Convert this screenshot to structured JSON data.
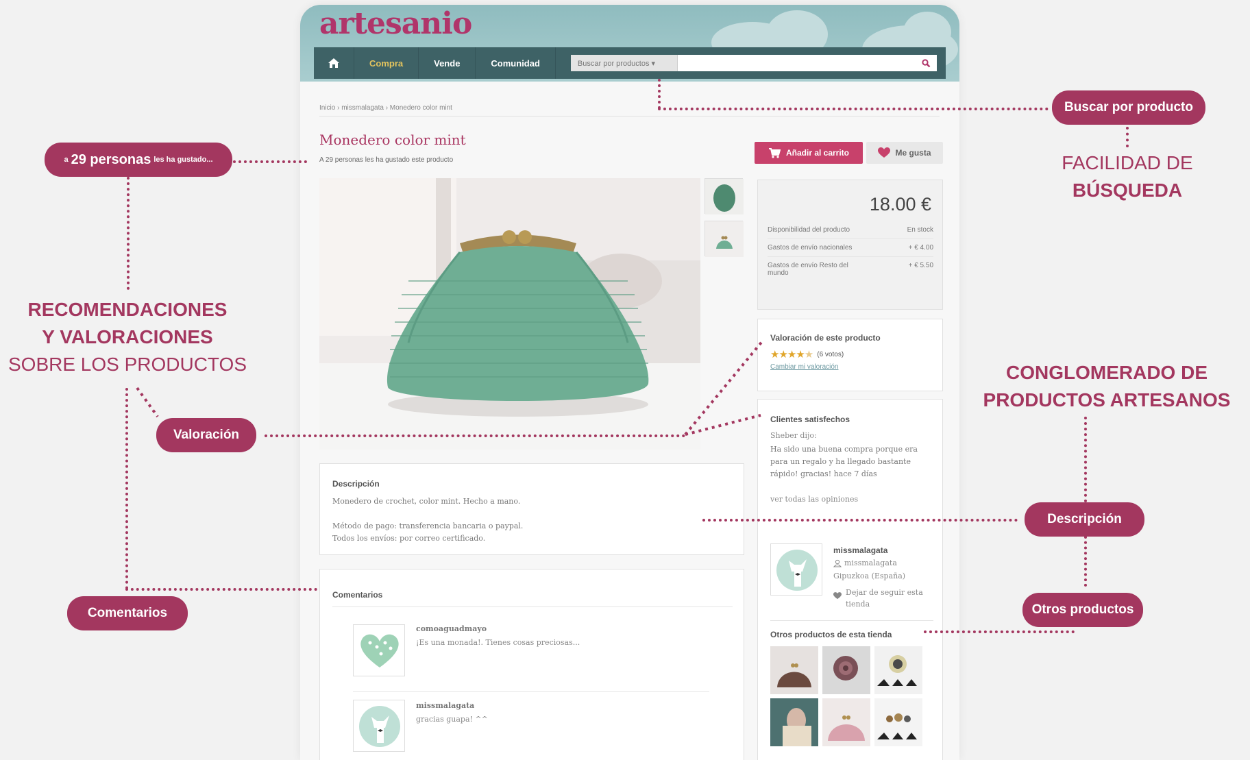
{
  "site": {
    "logo": "artesanio",
    "nav": {
      "compra": "Compra",
      "vende": "Vende",
      "comunidad": "Comunidad"
    },
    "search": {
      "select_label": "Buscar por productos ▾",
      "placeholder": ""
    },
    "breadcrumb": "Inicio › missmalagata › Monedero color mint",
    "product_title": "Monedero color mint",
    "likes_text": "A 29 personas les ha gustado este producto",
    "add_to_cart": "Añadir al carrito",
    "like": "Me gusta",
    "price": "18.00 €",
    "price_rows": [
      {
        "label": "Disponibilidad del producto",
        "value": "En stock"
      },
      {
        "label": "Gastos de envío nacionales",
        "value": "+ € 4.00"
      },
      {
        "label": "Gastos de envío Resto del mundo",
        "value": "+ € 5.50"
      }
    ],
    "rating": {
      "title": "Valoración de este producto",
      "stars": 4.5,
      "votes": "(6 votos)",
      "change_link": "Cambiar mi valoración"
    },
    "happy": {
      "title": "Clientes satisfechos",
      "author": "Sheber dijo:",
      "text": "Ha sido una buena compra porque era para un regalo y ha llegado bastante rápido! gracias! hace 7 días",
      "all_link": "ver todas las opiniones"
    },
    "description": {
      "title": "Descripción",
      "line1": "Monedero de crochet, color mint. Hecho a mano.",
      "line2": "Método de pago: transferencia bancaria o paypal.",
      "line3": "Todos los envíos: por correo certificado."
    },
    "seller": {
      "name": "missmalagata",
      "user": "missmalagata",
      "location": "Gipuzkoa (España)",
      "unfollow": "Dejar de seguir esta tienda"
    },
    "other_title": "Otros productos de esta tienda",
    "comments": {
      "title": "Comentarios",
      "items": [
        {
          "user": "comoaguadmayo",
          "text": "¡Es una monada!. Tienes cosas preciosas..."
        },
        {
          "user": "missmalagata",
          "text": "gracias guapa! ^^"
        }
      ]
    }
  },
  "annotations": {
    "buscar": "Buscar por producto",
    "facilidad_1": "FACILIDAD DE",
    "facilidad_2": "BÚSQUEDA",
    "personas_big": "29 personas",
    "personas_pre": "a",
    "personas_post": "les ha gustado...",
    "recom_1": "RECOMENDACIONES",
    "recom_2": "Y VALORACIONES",
    "recom_3": "SOBRE LOS PRODUCTOS",
    "valoracion": "Valoración",
    "comentarios": "Comentarios",
    "conglo_1": "CONGLOMERADO DE",
    "conglo_2": "PRODUCTOS ARTESANOS",
    "descripcion": "Descripción",
    "otros": "Otros productos"
  },
  "colors": {
    "brand": "#a3375f",
    "header": "#8fbcbf",
    "nav": "#3e6266",
    "cart_button": "#c8416b",
    "stars": "#e0a52a"
  }
}
